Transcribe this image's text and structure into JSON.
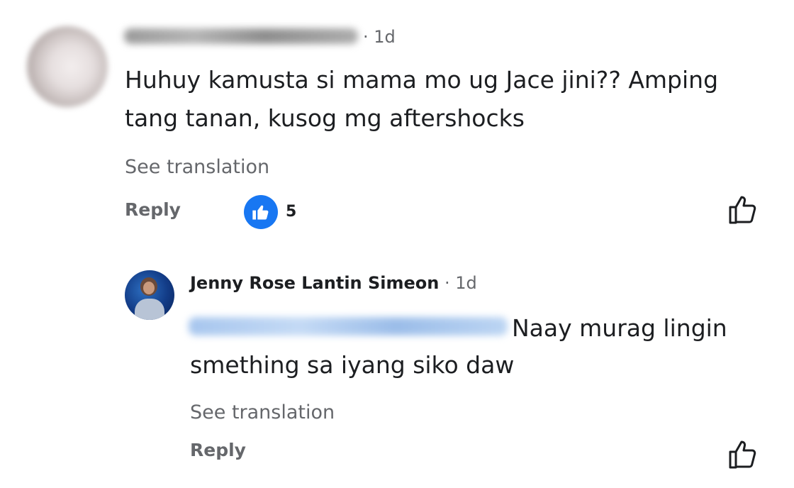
{
  "comment": {
    "time": "· 1d",
    "text": "Huhuy kamusta si mama mo ug Jace jini?? Amping tang tanan, kusog mg aftershocks",
    "see_translation": "See translation",
    "reply_label": "Reply",
    "reaction_icon": "like-reaction-icon",
    "reaction_count": "5",
    "like_icon": "thumbs-up-icon"
  },
  "reply": {
    "author": "Jenny Rose Lantin Simeon",
    "time": "· 1d",
    "text_line1": "Naay murag lingin",
    "text_line2": "smething sa iyang siko daw",
    "see_translation": "See translation",
    "reply_label": "Reply",
    "like_icon": "thumbs-up-icon"
  },
  "colors": {
    "primary_text": "#1c1e21",
    "secondary_text": "#65676b",
    "reaction_blue": "#1877f2",
    "mention_blue": "#1877f2"
  }
}
